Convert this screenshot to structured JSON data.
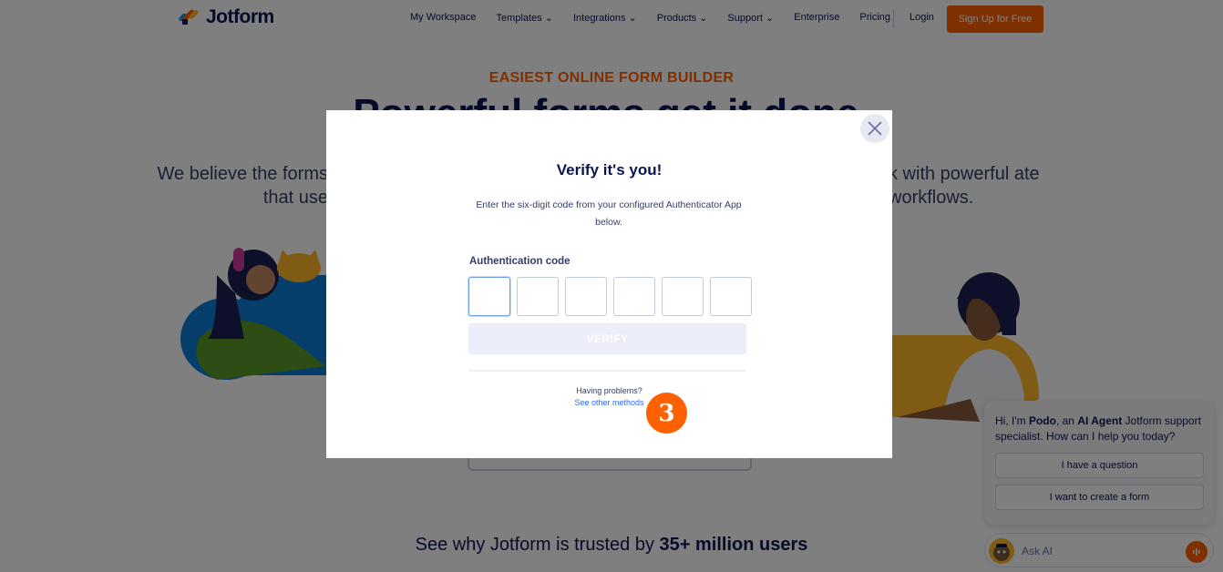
{
  "nav": {
    "brand": "Jotform",
    "links": [
      "My Workspace",
      "Templates ⌄",
      "Integrations ⌄",
      "Products ⌄",
      "Support ⌄",
      "Enterprise",
      "Pricing"
    ],
    "login": "Login",
    "signup": "Sign Up for Free"
  },
  "hero": {
    "eyebrow": "EASIEST ONLINE FORM BUILDER",
    "title": "Powerful forms get it done.",
    "left_text": "We believe the forms that use",
    "right_text": "k with powerful ate workflows."
  },
  "trusted": {
    "prefix": "See why Jotform is trusted by ",
    "emphasis": "35+ million users"
  },
  "modal": {
    "title": "Verify it's you!",
    "description": "Enter the six-digit code from your configured Authenticator App below.",
    "code_label": "Authentication code",
    "verify_label": "VERIFY",
    "problems_text": "Having problems?",
    "other_methods_link": "See other methods",
    "step_number": "3"
  },
  "chat": {
    "greeting_prefix": "Hi, I'm ",
    "bot_name": "Podo",
    "greeting_middle": ", an ",
    "agent_label": "AI Agent",
    "greeting_suffix": " Jotform support specialist. How can I help you today?",
    "option_1": "I have a question",
    "option_2": "I want to create a form",
    "ask_label": "Ask AI"
  },
  "colors": {
    "brand_orange": "#ff6100",
    "navy": "#0a1551",
    "link_blue": "#2e69ff"
  }
}
